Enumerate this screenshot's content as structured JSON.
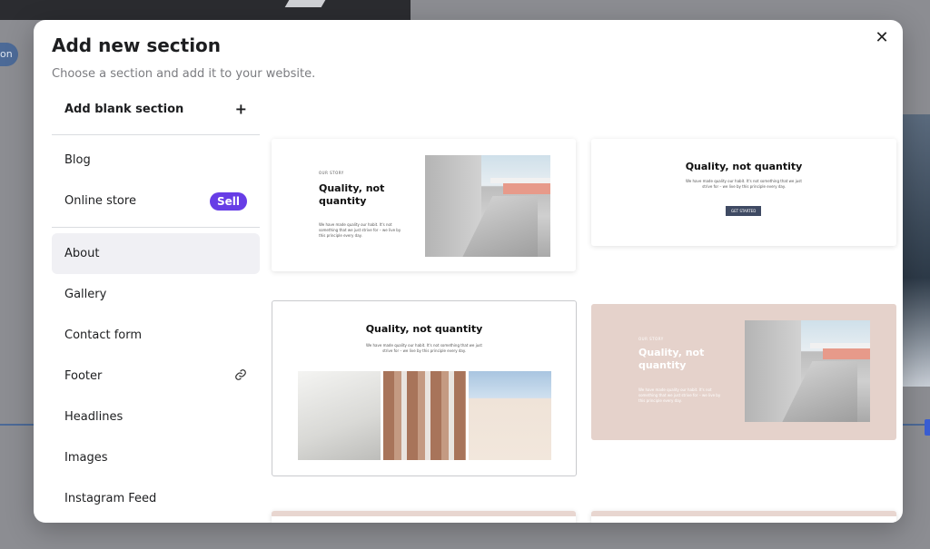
{
  "background": {
    "pill_text": "on"
  },
  "modal": {
    "title": "Add new section",
    "subtitle": "Choose a section and add it to your website.",
    "close_icon": "close-icon"
  },
  "sidebar": {
    "blank": {
      "label": "Add blank section",
      "icon": "plus-icon"
    },
    "items": [
      {
        "label": "Blog"
      },
      {
        "label": "Online store",
        "badge": "Sell"
      },
      {
        "label": "About",
        "active": true
      },
      {
        "label": "Gallery"
      },
      {
        "label": "Contact form"
      },
      {
        "label": "Footer",
        "icon": "link-icon"
      },
      {
        "label": "Headlines"
      },
      {
        "label": "Images"
      },
      {
        "label": "Instagram Feed"
      }
    ]
  },
  "templates": {
    "card1": {
      "eyebrow": "OUR STORY",
      "heading": "Quality, not quantity",
      "body": "We have made quality our habit. It's not something that we just strive for – we live by this principle every day."
    },
    "card2": {
      "heading": "Quality, not quantity",
      "body": "We have made quality our habit. It's not something that we just strive for – we live by this principle every day.",
      "button": "GET STARTED"
    },
    "card3": {
      "heading": "Quality, not quantity",
      "body": "We have made quality our habit. It's not something that we just strive for – we live by this principle every day."
    },
    "card4": {
      "eyebrow": "OUR STORY",
      "heading": "Quality, not quantity",
      "body": "We have made quality our habit. It's not something that we just strive for – we live by this principle every day."
    }
  },
  "colors": {
    "accent": "#673de6",
    "card4_bg": "#e5d2cb",
    "button": "#3f4a63"
  }
}
